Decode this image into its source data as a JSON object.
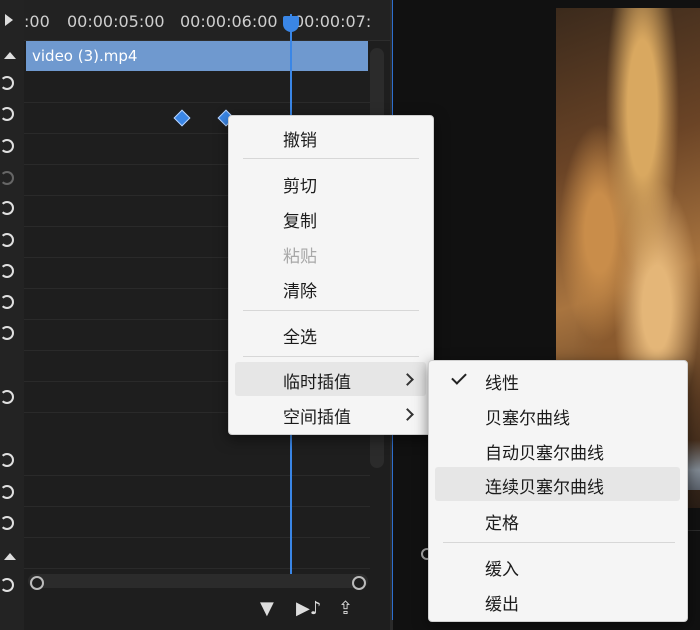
{
  "timeline": {
    "ruler_labels": [
      ":00",
      "00:00:05:00",
      "00:00:06:00",
      "00:00:07:"
    ],
    "clip_name": "video (3).mp4"
  },
  "context_menu": {
    "undo": "撤销",
    "cut": "剪切",
    "copy": "复制",
    "paste": "粘贴",
    "clear": "清除",
    "select_all": "全选",
    "temporal_interpolation": "临时插值",
    "spatial_interpolation": "空间插值"
  },
  "submenu": {
    "linear": "线性",
    "bezier": "贝塞尔曲线",
    "auto_bezier": "自动贝塞尔曲线",
    "continuous_bezier": "连续贝塞尔曲线",
    "hold": "定格",
    "ease_in": "缓入",
    "ease_out": "缓出",
    "checked_item": "linear"
  },
  "colors": {
    "accent": "#3a86e6",
    "clip": "#6f99cf",
    "menu_bg": "#f5f5f5"
  }
}
